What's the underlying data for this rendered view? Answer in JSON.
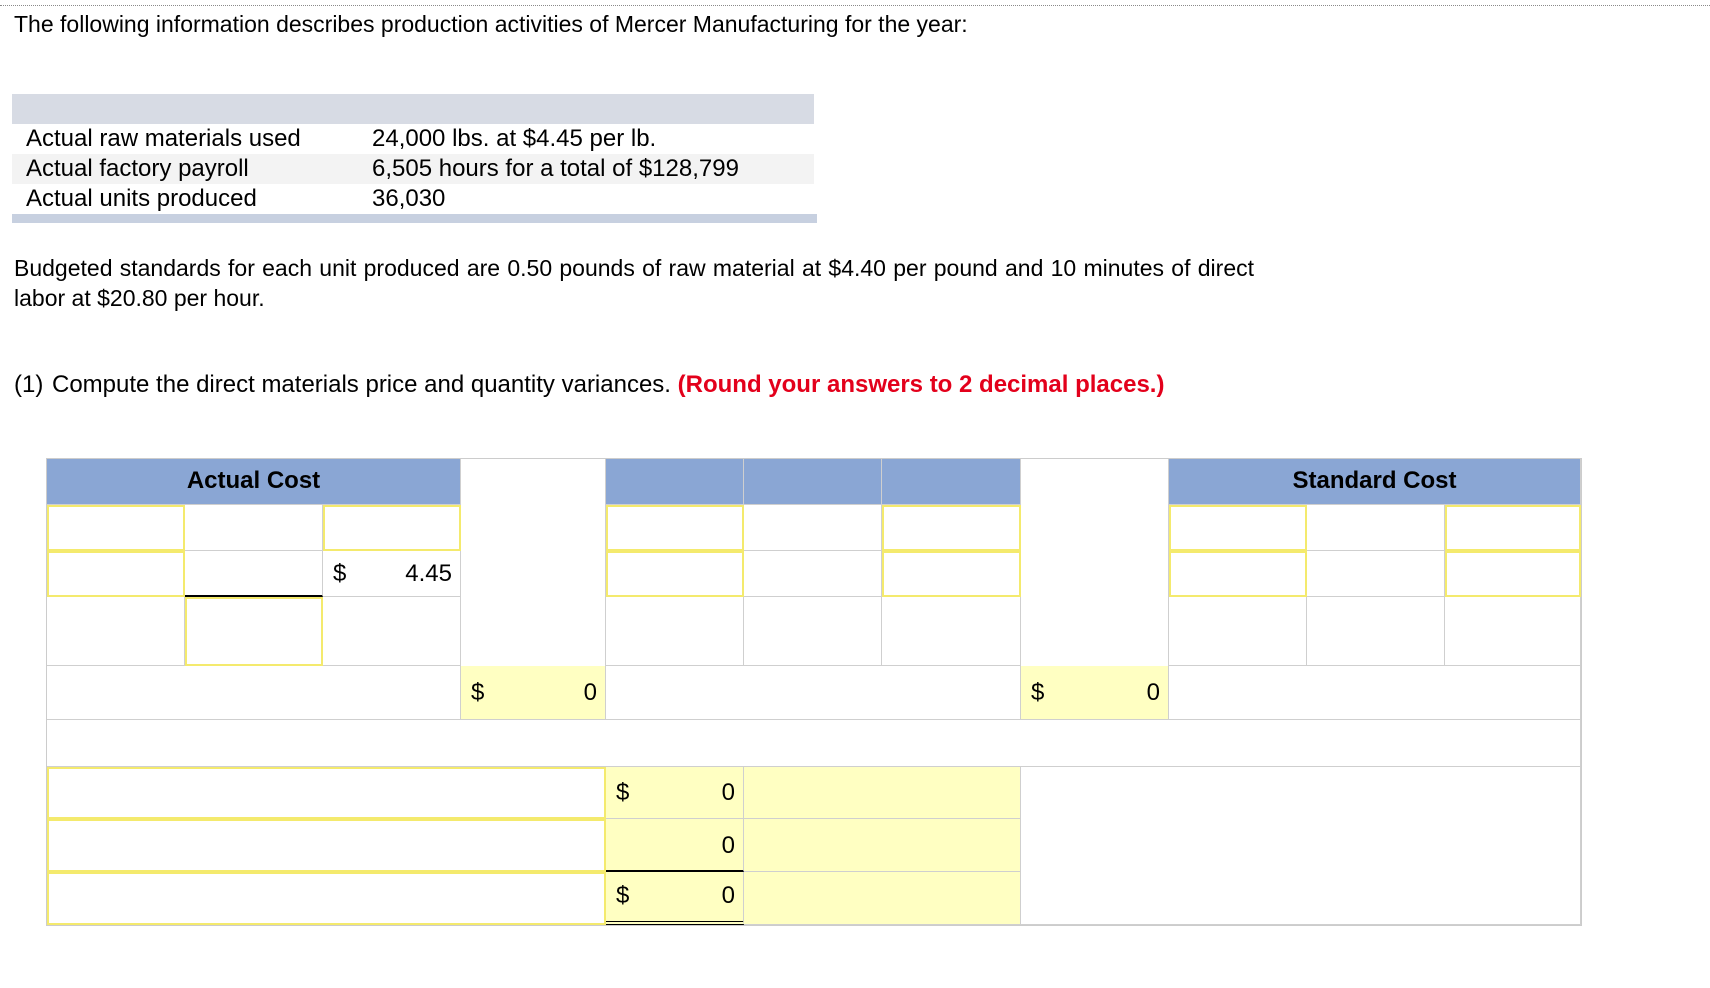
{
  "intro": "The following information describes production activities of Mercer Manufacturing for the year:",
  "info_table": {
    "rows": [
      {
        "label": "Actual raw materials used",
        "value": "24,000 lbs. at $4.45 per lb."
      },
      {
        "label": "Actual factory payroll",
        "value": "6,505 hours for a total of $128,799"
      },
      {
        "label": "Actual units produced",
        "value": "36,030"
      }
    ]
  },
  "budget_text": "Budgeted standards for each unit produced are 0.50 pounds of raw material at $4.40 per pound and 10 minutes of direct labor at $20.80 per hour.",
  "question": {
    "number": "(1)",
    "text": "Compute the direct materials price and quantity variances.",
    "instruction": "(Round your answers to 2 decimal places.)"
  },
  "worksheet": {
    "header_actual": "Actual Cost",
    "header_standard": "Standard Cost",
    "currency": "$",
    "actual_price": "4.45",
    "price_variance_value": "0",
    "quantity_variance_value": "0",
    "summary_values": [
      "0",
      "0",
      "0"
    ]
  },
  "colors": {
    "header_fill": "#8aa6d4",
    "input_border": "#f4ea6d",
    "output_fill": "#ffffc2",
    "instruction_red": "#e3001b"
  }
}
